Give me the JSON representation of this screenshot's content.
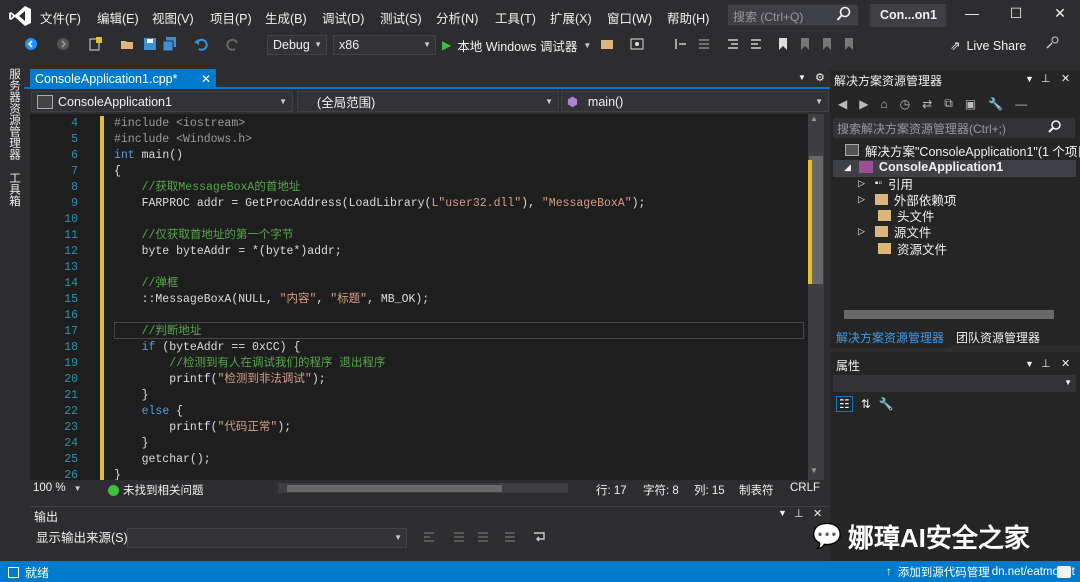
{
  "app": {
    "project_badge": "Con...on1"
  },
  "menu": [
    "文件(F)",
    "编辑(E)",
    "视图(V)",
    "项目(P)",
    "生成(B)",
    "调试(D)",
    "测试(S)",
    "分析(N)",
    "工具(T)",
    "扩展(X)",
    "窗口(W)",
    "帮助(H)"
  ],
  "search": {
    "placeholder": "搜索 (Ctrl+Q)"
  },
  "toolbar": {
    "config": "Debug",
    "platform": "x86",
    "run_label": "本地 Windows 调试器",
    "live_share": "Live Share"
  },
  "left_strip": [
    "服务器资源管理器",
    "工具箱"
  ],
  "editor": {
    "tab_label": "ConsoleApplication1.cpp*",
    "nav": {
      "project": "ConsoleApplication1",
      "scope": "(全局范围)",
      "member": "main()"
    },
    "lines": [
      {
        "n": "4",
        "t": "#include <iostream>"
      },
      {
        "n": "5",
        "t": "#include <Windows.h>"
      },
      {
        "n": "6",
        "t": "int main()"
      },
      {
        "n": "7",
        "t": "{"
      },
      {
        "n": "8",
        "t": "    //获取MessageBoxA的首地址"
      },
      {
        "n": "9",
        "t": "    FARPROC addr = GetProcAddress(LoadLibrary(L\"user32.dll\"), \"MessageBoxA\");"
      },
      {
        "n": "10",
        "t": ""
      },
      {
        "n": "11",
        "t": "    //仅获取首地址的第一个字节"
      },
      {
        "n": "12",
        "t": "    byte byteAddr = *(byte*)addr;"
      },
      {
        "n": "13",
        "t": ""
      },
      {
        "n": "14",
        "t": "    //弹框"
      },
      {
        "n": "15",
        "t": "    ::MessageBoxA(NULL, \"内容\", \"标题\", MB_OK);"
      },
      {
        "n": "16",
        "t": ""
      },
      {
        "n": "17",
        "t": "    //判断地址"
      },
      {
        "n": "18",
        "t": "    if (byteAddr == 0xCC) {"
      },
      {
        "n": "19",
        "t": "        //检测到有人在调试我们的程序 退出程序"
      },
      {
        "n": "20",
        "t": "        printf(\"检测到非法调试\");"
      },
      {
        "n": "21",
        "t": "    }"
      },
      {
        "n": "22",
        "t": "    else {"
      },
      {
        "n": "23",
        "t": "        printf(\"代码正常\");"
      },
      {
        "n": "24",
        "t": "    }"
      },
      {
        "n": "25",
        "t": "    getchar();"
      },
      {
        "n": "26",
        "t": "}"
      }
    ],
    "status": {
      "zoom": "100 %",
      "issues": "未找到相关问题",
      "line": "行: 17",
      "char": "字符: 8",
      "col": "列: 15",
      "tabs": "制表符",
      "eol": "CRLF"
    }
  },
  "output": {
    "title": "输出",
    "source_label": "显示输出来源(S):"
  },
  "solution_explorer": {
    "title": "解决方案资源管理器",
    "search_placeholder": "搜索解决方案资源管理器(Ctrl+;)",
    "solution": "解决方案\"ConsoleApplication1\"(1 个项目",
    "project": "ConsoleApplication1",
    "items": [
      "引用",
      "外部依赖项",
      "头文件",
      "源文件",
      "资源文件"
    ],
    "tabs": [
      "解决方案资源管理器",
      "团队资源管理器"
    ]
  },
  "properties": {
    "title": "属性"
  },
  "statusbar": {
    "ready": "就绪",
    "source_control": "添加到源代码管理",
    "partial_url": "dn.net/",
    "partial_user": "eatmount"
  },
  "watermark": "娜璋AI安全之家",
  "colors": {
    "accent": "#007acc",
    "bg": "#2d2d30",
    "editor_bg": "#1e1e1e",
    "comment": "#57a64a",
    "keyword": "#569cd6",
    "string": "#d69d85",
    "directive": "#9b9b9b",
    "modified_bar": "#e1c230"
  }
}
